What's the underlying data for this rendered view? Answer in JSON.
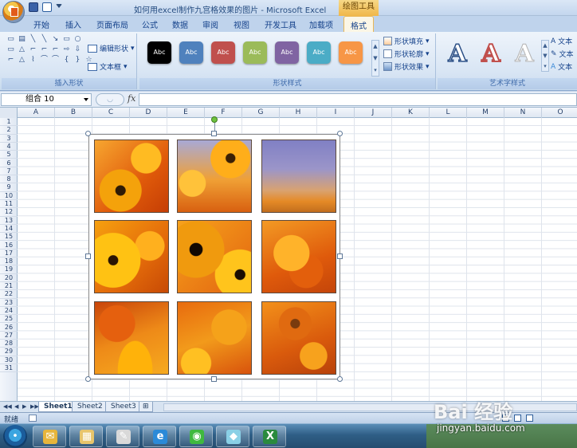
{
  "window": {
    "title": "如何用excel制作九宫格效果的图片 - Microsoft Excel",
    "context_tab_title": "绘图工具"
  },
  "tabs": [
    {
      "label": "开始"
    },
    {
      "label": "插入"
    },
    {
      "label": "页面布局"
    },
    {
      "label": "公式"
    },
    {
      "label": "数据"
    },
    {
      "label": "审阅"
    },
    {
      "label": "视图"
    },
    {
      "label": "开发工具"
    },
    {
      "label": "加载项"
    },
    {
      "label": "格式",
      "active": true
    }
  ],
  "ribbon": {
    "insert_shapes": {
      "label": "插入形状",
      "edit_shape": "编辑形状",
      "text_box": "文本框",
      "shape_glyphs": [
        "▭",
        "▤",
        "╲",
        "╲",
        "↘",
        "▭",
        "○",
        "",
        "▭",
        "△",
        "⌐",
        "⌐",
        "⌐",
        "⇨",
        "⇩",
        "",
        "⌐",
        "△",
        "⌇",
        "⌒",
        "⌒",
        "{",
        "}",
        "☆"
      ]
    },
    "shape_styles": {
      "label": "形状样式",
      "presets": [
        {
          "text": "Abc",
          "color": "#000000"
        },
        {
          "text": "Abc",
          "color": "#4f81bd"
        },
        {
          "text": "Abc",
          "color": "#c0504d"
        },
        {
          "text": "Abc",
          "color": "#9bbb59"
        },
        {
          "text": "Abc",
          "color": "#8064a2"
        },
        {
          "text": "Abc",
          "color": "#4bacc6"
        },
        {
          "text": "Abc",
          "color": "#f79646"
        }
      ],
      "fill": "形状填充",
      "outline": "形状轮廓",
      "effects": "形状效果"
    },
    "wordart": {
      "label": "艺术字样式",
      "sample": "A",
      "text_fill": "文本",
      "text_outline": "文本",
      "text_effects": "文本"
    }
  },
  "formula_bar": {
    "name_box": "组合 10",
    "fx": "fx",
    "value": ""
  },
  "columns": [
    "A",
    "B",
    "C",
    "D",
    "E",
    "F",
    "G",
    "H",
    "I",
    "J",
    "K",
    "L",
    "M",
    "N",
    "O"
  ],
  "rows": [
    "1",
    "2",
    "3",
    "4",
    "5",
    "6",
    "7",
    "8",
    "9",
    "10",
    "11",
    "12",
    "13",
    "14",
    "15",
    "16",
    "17",
    "18",
    "19",
    "20",
    "21",
    "22",
    "23",
    "24",
    "25",
    "26",
    "27",
    "28",
    "29",
    "30",
    "31"
  ],
  "picture": {
    "tiles": [
      {
        "name": "tile-1",
        "bg": "radial-gradient(circle at 35% 70%, #2e1a05 0 7%, #f4a20b 8% 30%, transparent 31%), radial-gradient(circle at 70% 25%, #ffbb22 0 20%, transparent 21%), linear-gradient(135deg, #f7a630, #e05a0a 60%, #c53e05)"
      },
      {
        "name": "tile-2",
        "bg": "radial-gradient(circle at 72% 25%, #3a2005 0 6%, #ffae1a 7% 26%, transparent 27%), radial-gradient(circle at 20% 60%, #ffc23a 0 18%, transparent 19%), linear-gradient(180deg, #a8a9d6, #f0a035 55%, #d86010)"
      },
      {
        "name": "tile-3",
        "bg": "linear-gradient(180deg, #8080c4 0%, #9b95c9 40%, #d9a270 70%, #e58a26 85%, #c26e1e 100%)"
      },
      {
        "name": "tile-4",
        "bg": "radial-gradient(circle at 25% 55%, #2a1403 0 7%, #ffc213 8% 40%, transparent 41%), radial-gradient(circle at 75% 35%, #ffb01e 0 20%, transparent 21%), linear-gradient(135deg, #f6a00f, #e36a0a 60%, #c74a05)"
      },
      {
        "name": "tile-5",
        "bg": "radial-gradient(circle at 25% 40%, #120802 0 9%, #f09a0e 10% 40%, transparent 41%), radial-gradient(circle at 85% 75%, #1b0c02 0 6%, #ffc41c 7% 30%, transparent 31%), linear-gradient(135deg, #f7a21c, #e26410)"
      },
      {
        "name": "tile-6",
        "bg": "radial-gradient(circle at 40% 45%, #ffb32a 0 30%, transparent 31%), radial-gradient(circle at 60% 70%, #e35f0c 0 25%, transparent 26%), linear-gradient(160deg, #f39a24, #df5a0b 60%, #c4450a)"
      },
      {
        "name": "tile-7",
        "bg": "radial-gradient(ellipse at 55% 95%, #ffb20a 0 30%, transparent 31%), radial-gradient(circle at 30% 30%, #e5600e 0 25%, transparent 26%), linear-gradient(160deg, #c9450a, #ee8a18 50%, #f6aa1f)"
      },
      {
        "name": "tile-8",
        "bg": "radial-gradient(circle at 70% 35%, #f5a21a 0 25%, transparent 26%), radial-gradient(circle at 25% 85%, #ffc022 0 18%, transparent 19%), linear-gradient(160deg, #e86b0e, #f29a1b 50%, #d8530c)"
      },
      {
        "name": "tile-9",
        "bg": "radial-gradient(circle at 45% 30%, #7a3b0e 0 7%, #e06a10 8% 25%, transparent 26%), radial-gradient(circle at 70% 75%, #f7a21d 0 18%, transparent 19%), linear-gradient(160deg, #f3901a, #d95a0c 60%, #b8420a)"
      }
    ]
  },
  "sheets": [
    {
      "label": "Sheet1",
      "active": true
    },
    {
      "label": "Sheet2"
    },
    {
      "label": "Sheet3"
    }
  ],
  "status": {
    "ready": "就绪"
  },
  "taskbar": {
    "apps": [
      {
        "name": "outlook-icon",
        "glyph": "✉",
        "color": "#e7b53b"
      },
      {
        "name": "explorer-icon",
        "glyph": "▦",
        "color": "#e8c56b"
      },
      {
        "name": "paint-icon",
        "glyph": "✎",
        "color": "#d9d9d9"
      },
      {
        "name": "ie-icon",
        "glyph": "e",
        "color": "#2b8ad8"
      },
      {
        "name": "wechat-icon",
        "glyph": "◉",
        "color": "#3fb93f"
      },
      {
        "name": "notes-icon",
        "glyph": "◆",
        "color": "#8ad0e6"
      },
      {
        "name": "excel-icon",
        "glyph": "X",
        "color": "#2a8a3e"
      }
    ]
  },
  "watermark": {
    "brand": "Bai 经验",
    "url": "jingyan.baidu.com"
  }
}
